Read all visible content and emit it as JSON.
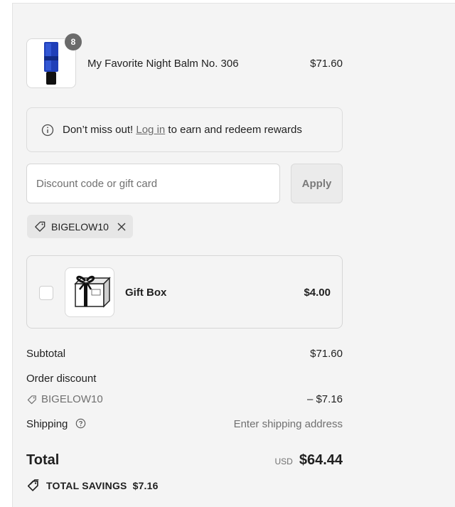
{
  "product": {
    "name": "My Favorite Night Balm No. 306",
    "price": "$71.60",
    "quantity": "8",
    "image_icon": "tube-product-icon"
  },
  "rewards_notice": {
    "prefix": "Don’t miss out!",
    "link_text": "Log in",
    "suffix": "to earn and redeem rewards"
  },
  "discount": {
    "placeholder": "Discount code or gift card",
    "value": "",
    "apply_label": "Apply",
    "applied_code": "BIGELOW10"
  },
  "upsell": {
    "name": "Gift Box",
    "price": "$4.00",
    "checked": false
  },
  "summary": {
    "subtotal_label": "Subtotal",
    "subtotal_value": "$71.60",
    "order_discount_label": "Order discount",
    "discount_code": "BIGELOW10",
    "discount_value": "– $7.16",
    "shipping_label": "Shipping",
    "shipping_value": "Enter shipping address",
    "total_label": "Total",
    "currency": "USD",
    "total_value": "$64.44",
    "savings_label": "TOTAL SAVINGS",
    "savings_value": "$7.16"
  },
  "colors": {
    "panel_bg": "#f4f4f4",
    "muted_text": "#707070",
    "badge_bg": "#6b6b6b"
  }
}
